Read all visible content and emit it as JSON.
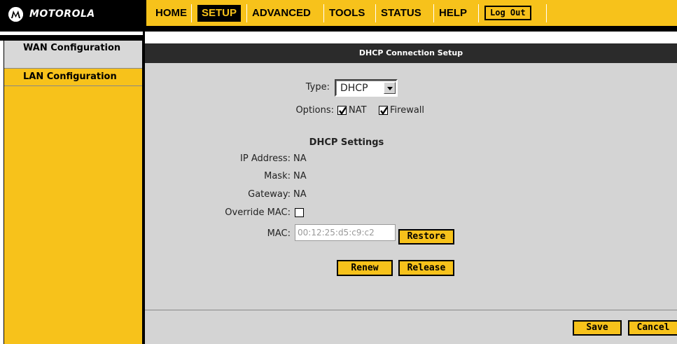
{
  "brand": {
    "name": "MOTOROLA",
    "logo_icon": "motorola-batwing-icon"
  },
  "nav": {
    "items": [
      {
        "label": "HOME",
        "active": false
      },
      {
        "label": "SETUP",
        "active": true
      },
      {
        "label": "ADVANCED",
        "active": false
      },
      {
        "label": "TOOLS",
        "active": false
      },
      {
        "label": "STATUS",
        "active": false
      },
      {
        "label": "HELP",
        "active": false
      }
    ],
    "logout_label": "Log Out"
  },
  "sidebar": {
    "items": [
      {
        "label": "WAN Configuration",
        "selected": true
      },
      {
        "label": "LAN Configuration",
        "selected": false
      }
    ]
  },
  "panel": {
    "title": "DHCP Connection Setup",
    "type_label": "Type:",
    "type_value": "DHCP",
    "options_label": "Options:",
    "options": [
      {
        "label": "NAT",
        "checked": true
      },
      {
        "label": "Firewall",
        "checked": true
      }
    ],
    "settings_heading": "DHCP Settings",
    "ip_label": "IP Address:",
    "ip_value": "NA",
    "mask_label": "Mask:",
    "mask_value": "NA",
    "gateway_label": "Gateway:",
    "gateway_value": "NA",
    "override_label": "Override MAC:",
    "override_checked": false,
    "mac_label": "MAC:",
    "mac_value": "00:12:25:d5:c9:c2",
    "restore_label": "Restore",
    "renew_label": "Renew",
    "release_label": "Release",
    "save_label": "Save",
    "cancel_label": "Cancel"
  },
  "colors": {
    "accent": "#f7c21b",
    "dark": "#000000",
    "panel": "#d4d4d4",
    "header": "#2b2b2b"
  }
}
